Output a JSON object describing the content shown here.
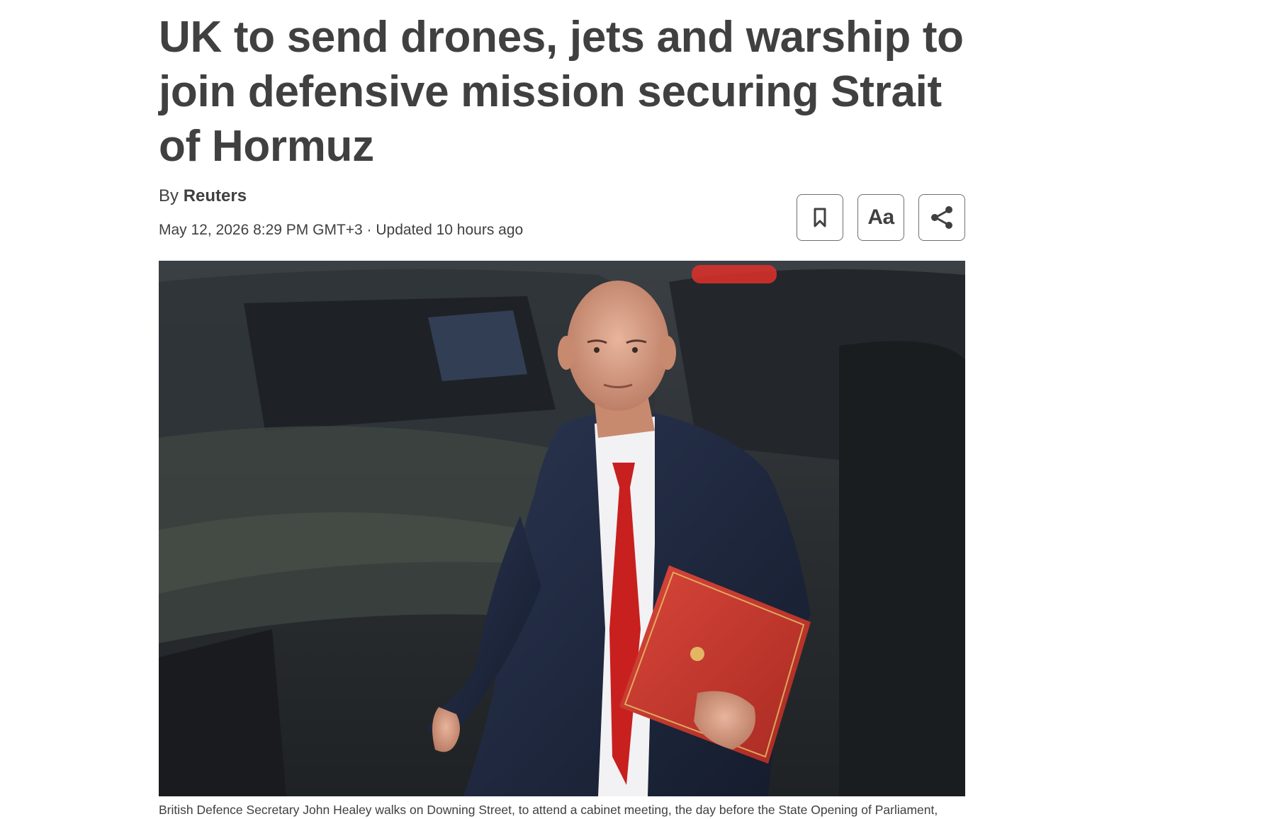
{
  "article": {
    "headline": "UK to send drones, jets and warship to join defensive mission securing Strait of Hormuz",
    "byline_prefix": "By",
    "author": "Reuters",
    "dateline": "May 12, 2026 8:29 PM GMT+3 · Updated 10 hours ago",
    "caption": "British Defence Secretary John Healey walks on Downing Street, to attend a cabinet meeting, the day before the State Opening of Parliament,"
  },
  "toolbar": {
    "bookmark_icon": "bookmark-icon",
    "font_size_label": "Aa",
    "share_icon": "share-icon"
  },
  "colors": {
    "text": "#404040",
    "button_border": "#6f6f6f",
    "background": "#ffffff"
  }
}
